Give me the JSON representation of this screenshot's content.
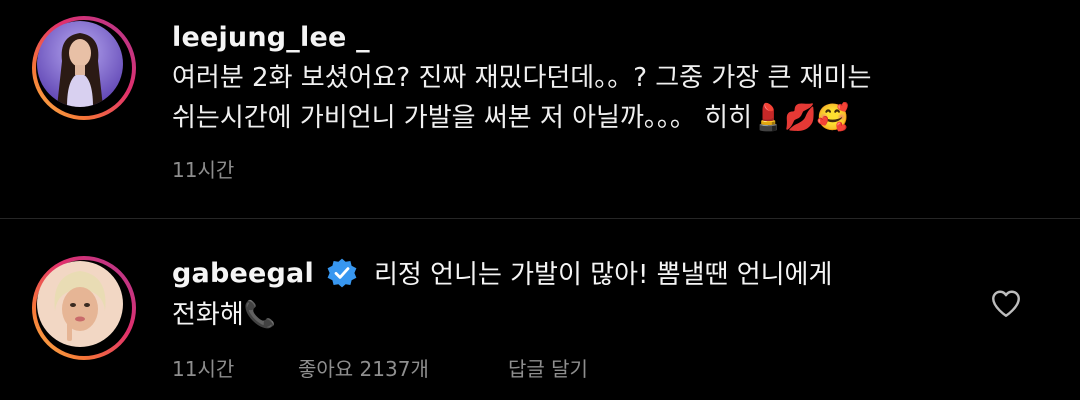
{
  "caption": {
    "username": "leejung_lee _",
    "line1": "여러분 2화 보셨어요? 진짜 재밌다던데。。? 그중 가장 큰 재미는",
    "line2": "쉬는시간에 가비언니 가발을 써본 저 아닐까。。。 히히💄💋🥰",
    "time": "11시간"
  },
  "reply": {
    "username": "gabeegal",
    "text_line1": "리정 언니는 가발이 많아! 뽐낼땐 언니에게",
    "text_line2": "전화해📞",
    "time": "11시간",
    "likes": "좋아요 2137개",
    "reply_label": "답글 달기"
  },
  "icons": {
    "verified": "verified-badge-icon",
    "like": "heart-icon"
  },
  "colors": {
    "background": "#000000",
    "text": "#f5f5f5",
    "meta": "#8e8e8e",
    "verified": "#3897f0",
    "divider": "#262626"
  }
}
